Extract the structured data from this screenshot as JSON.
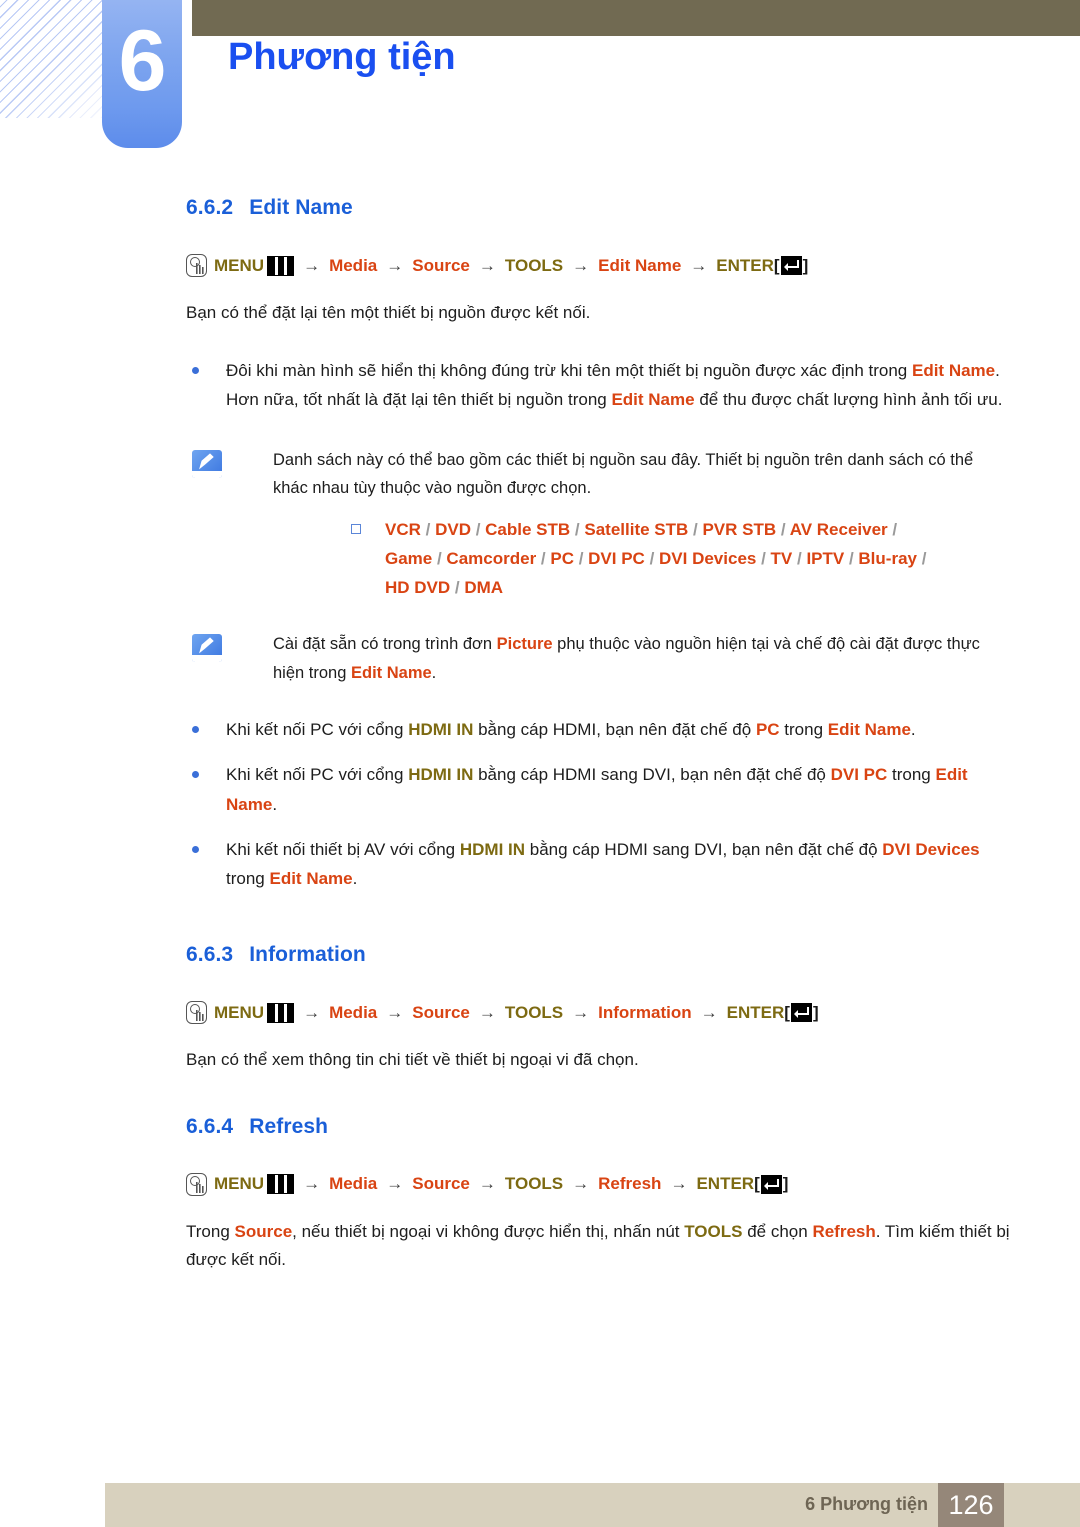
{
  "header": {
    "chapter_number": "6",
    "chapter_title": "Phương tiện",
    "accent_blue": "#1a4ff0",
    "olive_bar_color": "#716a52",
    "badge_color": "#6e9aee"
  },
  "colors": {
    "heading_blue": "#1a5fd8",
    "menu_olive": "#7d6a12",
    "menu_red": "#d94413",
    "bullet_blue": "#3a6fd8",
    "footer_bg": "#d8d1be",
    "page_box": "#958779"
  },
  "sections": [
    {
      "number": "6.6.2",
      "title": "Edit Name",
      "menu_path": {
        "menu_label": "MENU",
        "items": [
          {
            "label": "Media",
            "color": "red"
          },
          {
            "label": "Source",
            "color": "red"
          },
          {
            "label": "TOOLS",
            "color": "olive"
          },
          {
            "label": "Edit Name",
            "color": "red"
          }
        ],
        "enter_label": "ENTER"
      },
      "intro": "Bạn có thể đặt lại tên một thiết bị nguồn được kết nối."
    },
    {
      "number": "6.6.3",
      "title": "Information",
      "menu_path": {
        "menu_label": "MENU",
        "items": [
          {
            "label": "Media",
            "color": "red"
          },
          {
            "label": "Source",
            "color": "red"
          },
          {
            "label": "TOOLS",
            "color": "olive"
          },
          {
            "label": "Information",
            "color": "red"
          }
        ],
        "enter_label": "ENTER"
      },
      "intro": "Bạn có thể xem thông tin chi tiết về thiết bị ngoại vi đã chọn."
    },
    {
      "number": "6.6.4",
      "title": "Refresh",
      "menu_path": {
        "menu_label": "MENU",
        "items": [
          {
            "label": "Media",
            "color": "red"
          },
          {
            "label": "Source",
            "color": "red"
          },
          {
            "label": "TOOLS",
            "color": "olive"
          },
          {
            "label": "Refresh",
            "color": "red"
          }
        ],
        "enter_label": "ENTER"
      }
    }
  ],
  "edit_name": {
    "bullet1": {
      "p1": "Đôi khi màn hình sẽ hiển thị không đúng trừ khi tên một thiết bị nguồn được xác định trong ",
      "b1": "Edit Name",
      "p2": ". Hơn nữa, tốt nhất là đặt lại tên thiết bị nguồn trong ",
      "b2": "Edit Name",
      "p3": " để thu được chất lượng hình ảnh tối ưu."
    },
    "note1": {
      "text": "Danh sách này có thể bao gồm các thiết bị nguồn sau đây. Thiết bị nguồn trên danh sách có thể khác nhau tùy thuộc vào nguồn được chọn.",
      "device_list_line1": [
        "VCR",
        "DVD",
        "Cable STB",
        "Satellite STB",
        "PVR STB",
        "AV Receiver",
        "Game",
        "Camcorder"
      ],
      "device_list_line2": [
        "PC",
        "DVI PC",
        "DVI Devices",
        "TV",
        "IPTV",
        "Blu-ray",
        "HD DVD",
        "DMA"
      ]
    },
    "note2": {
      "p1": "Cài đặt sẵn có trong trình đơn ",
      "b1": "Picture",
      "p2": " phụ thuộc vào nguồn hiện tại và chế độ cài đặt được thực hiện trong ",
      "b2": "Edit Name",
      "p3": "."
    },
    "bullet_hdmi_1": {
      "p1": "Khi kết nối PC với cổng ",
      "b1": "HDMI IN",
      "p2": " bằng cáp HDMI, bạn nên đặt chế độ ",
      "b2": "PC",
      "p3": " trong ",
      "b3": "Edit Name",
      "p4": "."
    },
    "bullet_hdmi_2": {
      "p1": "Khi kết nối PC với cổng ",
      "b1": "HDMI IN",
      "p2": " bằng cáp HDMI sang DVI, bạn nên đặt chế độ ",
      "b2": "DVI PC",
      "p3": " trong ",
      "b3": "Edit Name",
      "p4": "."
    },
    "bullet_hdmi_3": {
      "p1": "Khi kết nối thiết bị AV với cổng ",
      "b1": "HDMI IN",
      "p2": " bằng cáp HDMI sang DVI, bạn nên đặt chế độ ",
      "b2": "DVI Devices",
      "p3": " trong ",
      "b3": "Edit Name",
      "p4": "."
    }
  },
  "refresh": {
    "p1": "Trong ",
    "b1": "Source",
    "p2": ", nếu thiết bị ngoại vi không được hiển thị, nhấn nút ",
    "b2": "TOOLS",
    "p3": " để chọn ",
    "b3": "Refresh",
    "p4": ". Tìm kiếm thiết bị được kết nối."
  },
  "footer": {
    "label": "6 Phương tiện",
    "page_number": "126"
  }
}
